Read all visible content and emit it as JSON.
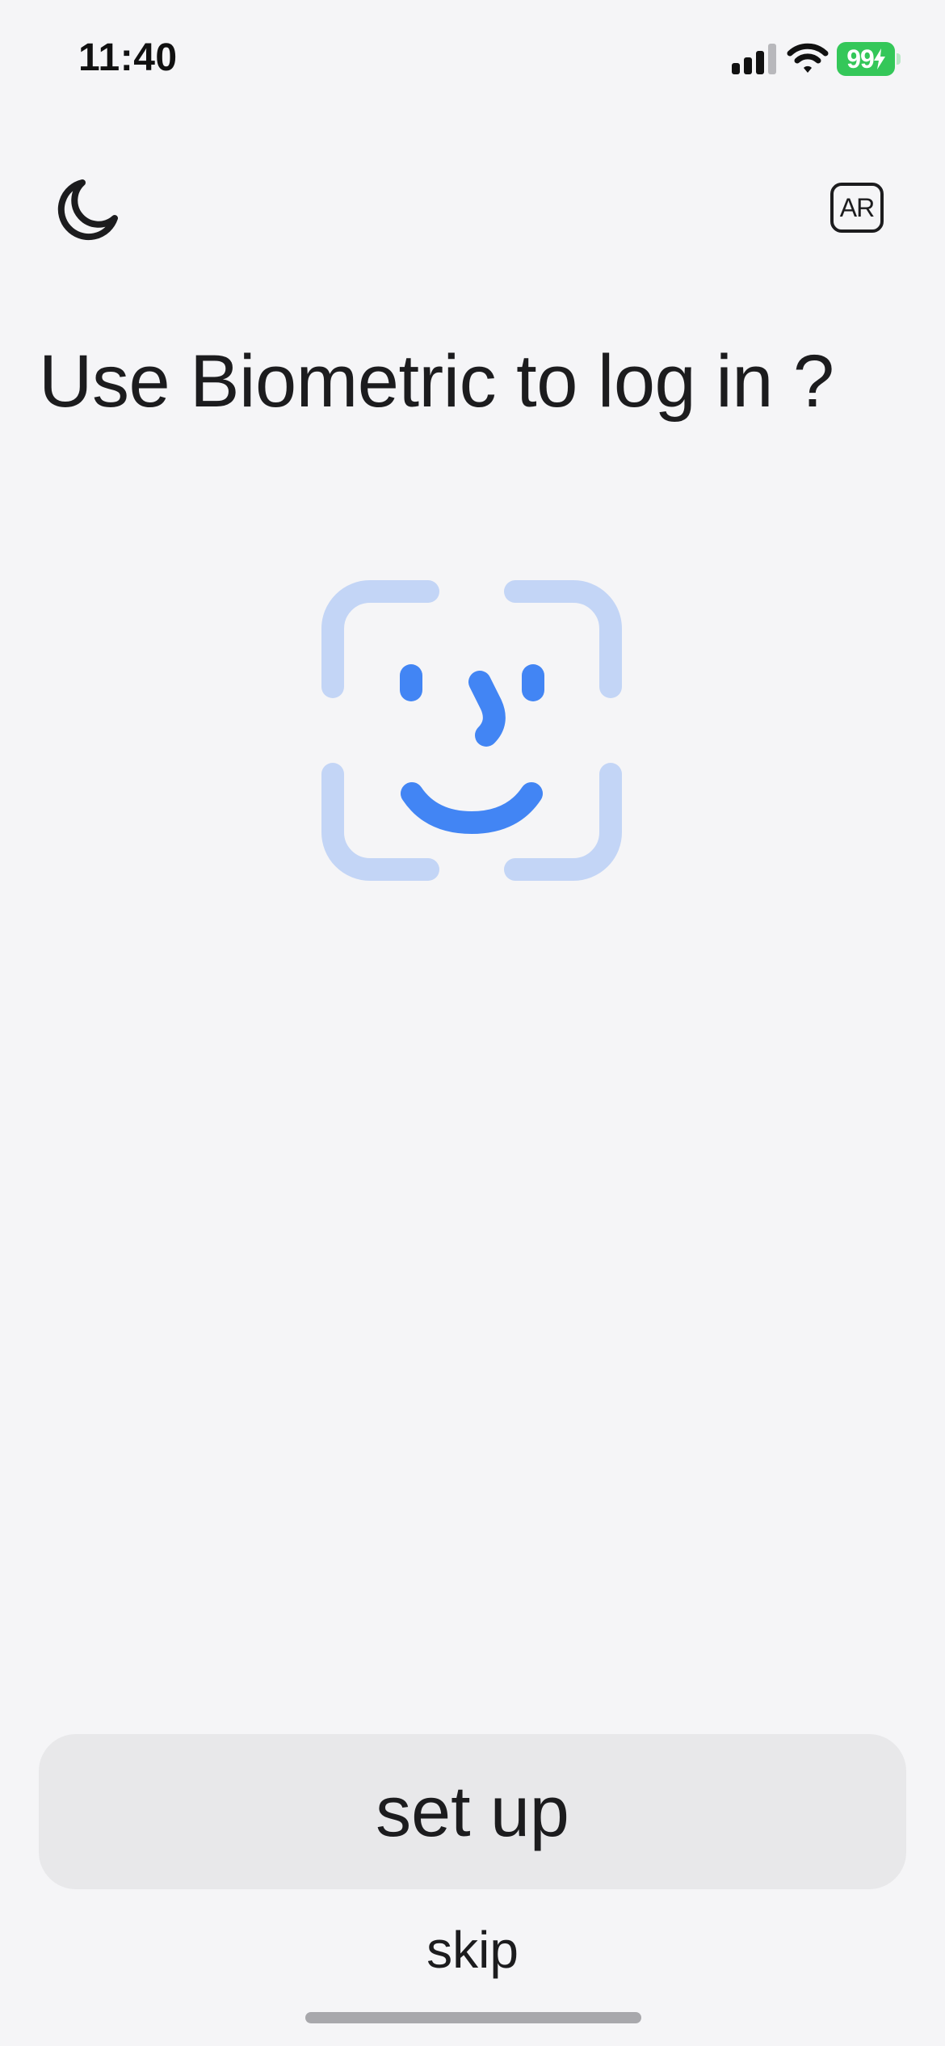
{
  "status_bar": {
    "time": "11:40",
    "battery_percent": "99",
    "battery_color": "#34c759",
    "signal_icon": "cellular-signal-icon",
    "wifi_icon": "wifi-icon"
  },
  "header": {
    "theme_toggle_icon": "moon-icon",
    "language_label": "AR"
  },
  "main": {
    "title": "Use Biometric to log in ?",
    "illustration_icon": "face-id-icon",
    "accent_color": "#4285f4",
    "accent_light_color": "#c3d5f6"
  },
  "actions": {
    "setup_label": "set up",
    "skip_label": "skip"
  }
}
